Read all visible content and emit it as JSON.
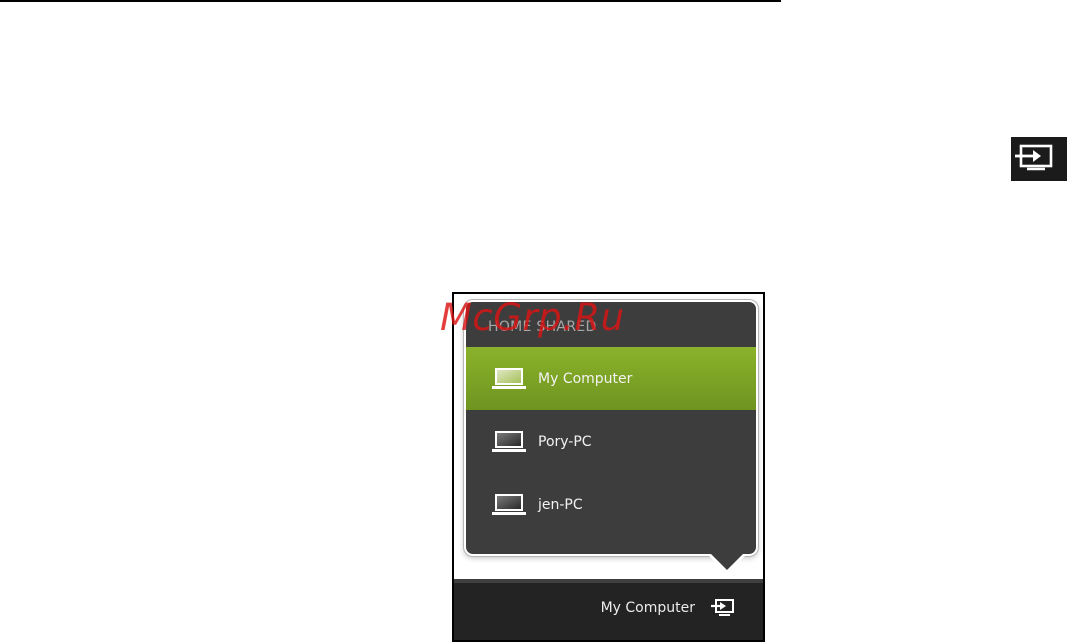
{
  "watermark": {
    "text": "McGrp.Ru",
    "color": "#dc1414"
  },
  "source_icon": {
    "icon": "play-to-device-icon"
  },
  "flyout": {
    "section_heading": "HOME SHARED",
    "selected_color": "#7fa526",
    "devices": [
      {
        "label": "My Computer",
        "icon": "laptop-icon",
        "selected": true
      },
      {
        "label": "Pory-PC",
        "icon": "laptop-icon",
        "selected": false
      },
      {
        "label": "jen-PC",
        "icon": "laptop-icon",
        "selected": false
      }
    ]
  },
  "taskbar": {
    "current_device_label": "My Computer",
    "icon": "play-to-device-icon"
  }
}
